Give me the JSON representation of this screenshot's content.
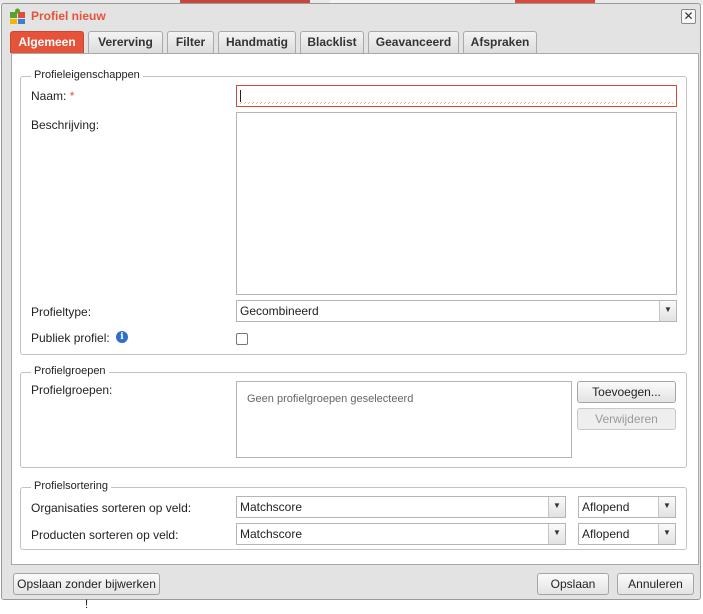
{
  "window": {
    "title": "Profiel nieuw"
  },
  "tabs": [
    "Algemeen",
    "Vererving",
    "Filter",
    "Handmatig",
    "Blacklist",
    "Geavanceerd",
    "Afspraken"
  ],
  "profile_properties": {
    "legend": "Profieleigenschappen",
    "name_label": "Naam:",
    "required_mark": "*",
    "name_value": "",
    "description_label": "Beschrijving:",
    "description_value": "",
    "type_label": "Profieltype:",
    "type_value": "Gecombineerd",
    "public_label": "Publiek profiel:",
    "info_icon": "i"
  },
  "profile_groups": {
    "legend": "Profielgroepen",
    "label": "Profielgroepen:",
    "empty_text": "Geen profielgroepen geselecteerd",
    "add_label": "Toevoegen...",
    "remove_label": "Verwijderen"
  },
  "profile_sorting": {
    "legend": "Profielsortering",
    "org_label": "Organisaties sorteren op veld:",
    "org_field": "Matchscore",
    "org_order": "Aflopend",
    "prod_label": "Producten sorteren op veld:",
    "prod_field": "Matchscore",
    "prod_order": "Aflopend"
  },
  "footer": {
    "save_no_update_label": "Opslaan zonder bijwerken !",
    "save_label": "Opslaan",
    "cancel_label": "Annuleren"
  },
  "colors": {
    "accent": "#e5533a",
    "info": "#2f6fc7"
  },
  "icons": {
    "app": "puzzle-icon",
    "close": "close-icon",
    "info": "info-icon",
    "dropdown": "chevron-down-icon"
  }
}
